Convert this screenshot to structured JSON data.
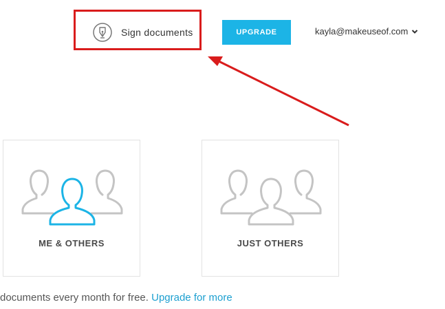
{
  "header": {
    "sign_documents_label": "Sign documents",
    "upgrade_label": "UPGRADE",
    "account_email": "kayla@makeuseof.com"
  },
  "cards": [
    {
      "label": "ME & OTHERS",
      "icon": "group-me-others-icon"
    },
    {
      "label": "JUST OTHERS",
      "icon": "group-just-others-icon"
    }
  ],
  "footer": {
    "text": "documents every month for free.",
    "link": "Upgrade for more"
  },
  "colors": {
    "accent": "#1cb4e6",
    "link": "#1c9fd0",
    "highlight": "#d91c1c",
    "icon_gray": "#c4c4c4"
  }
}
